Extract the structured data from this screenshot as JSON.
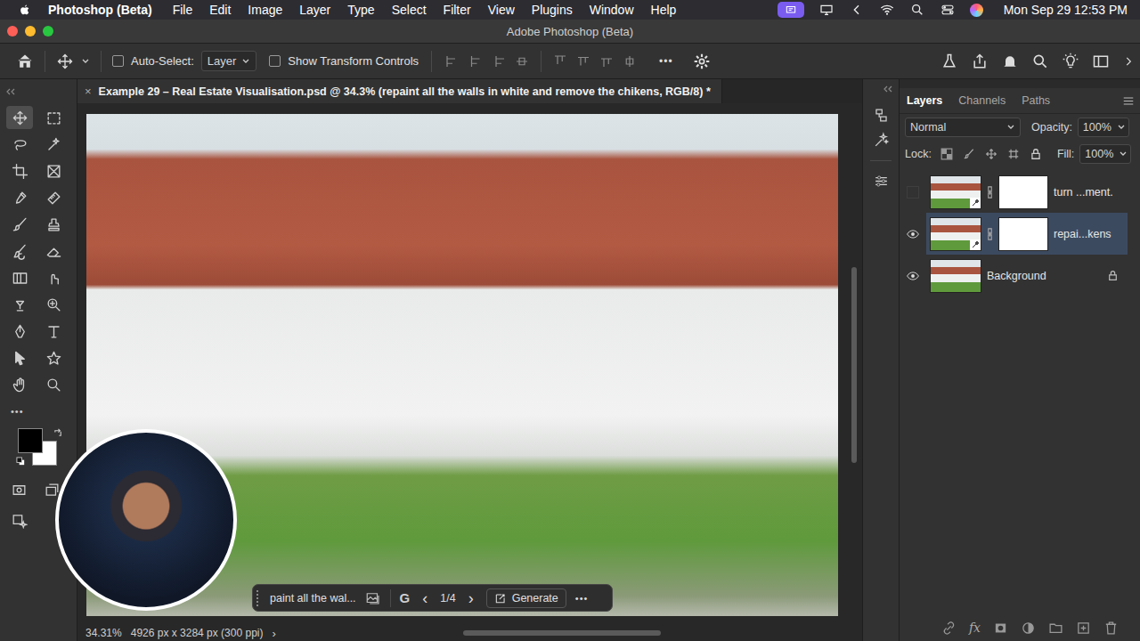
{
  "menubar": {
    "app": "Photoshop (Beta)",
    "menus": [
      "File",
      "Edit",
      "Image",
      "Layer",
      "Type",
      "Select",
      "Filter",
      "View",
      "Plugins",
      "Window",
      "Help"
    ],
    "clock": "Mon Sep 29  12:53 PM"
  },
  "window": {
    "title": "Adobe Photoshop (Beta)"
  },
  "options_bar": {
    "auto_select": {
      "label": "Auto-Select:",
      "checked": false
    },
    "target": "Layer",
    "transform": {
      "label": "Show Transform Controls",
      "checked": false
    },
    "more": "•••"
  },
  "toolbar": {
    "tools": [
      {
        "kind": "move",
        "selected": true
      },
      {
        "kind": "marquee",
        "selected": false
      },
      {
        "kind": "lasso",
        "selected": false
      },
      {
        "kind": "quick-select",
        "selected": false
      },
      {
        "kind": "crop",
        "selected": false
      },
      {
        "kind": "frame",
        "selected": false
      },
      {
        "kind": "eyedropper",
        "selected": false
      },
      {
        "kind": "healing",
        "selected": false
      },
      {
        "kind": "brush",
        "selected": false
      },
      {
        "kind": "stamp",
        "selected": false
      },
      {
        "kind": "history-brush",
        "selected": false
      },
      {
        "kind": "eraser",
        "selected": false
      },
      {
        "kind": "gradient",
        "selected": false
      },
      {
        "kind": "smudge",
        "selected": false
      },
      {
        "kind": "dodge",
        "selected": false
      },
      {
        "kind": "sponge",
        "selected": false
      },
      {
        "kind": "pen",
        "selected": false
      },
      {
        "kind": "type",
        "selected": false
      },
      {
        "kind": "path-select",
        "selected": false
      },
      {
        "kind": "shape",
        "selected": false
      },
      {
        "kind": "hand",
        "selected": false
      },
      {
        "kind": "zoom",
        "selected": false
      }
    ],
    "more": "•••",
    "foreground_color": "#000000",
    "background_color": "#ffffff"
  },
  "document": {
    "close": "×",
    "title": "Example 29 – Real Estate Visualisation.psd @ 34.3% (repaint all the walls in white and remove the chikens, RGB/8) *"
  },
  "contextual_taskbar": {
    "prompt": "paint all the wal...",
    "model_badge": "G",
    "prev": "‹",
    "counter": "1/4",
    "next": "›",
    "generate": "Generate",
    "more": "•••"
  },
  "status_bar": {
    "zoom": "34.31%",
    "dimensions": "4926 px x 3284 px (300 ppi)",
    "arrow": "›"
  },
  "layers_panel": {
    "tabs": [
      {
        "label": "Layers",
        "selected": true
      },
      {
        "label": "Channels",
        "selected": false
      },
      {
        "label": "Paths",
        "selected": false
      }
    ],
    "blend_mode": "Normal",
    "opacity": {
      "label": "Opacity:",
      "value": "100%"
    },
    "lock_label": "Lock:",
    "fill": {
      "label": "Fill:",
      "value": "100%"
    },
    "layers": [
      {
        "name": "turn ...ment.",
        "kind": "generative",
        "visible": false,
        "selected": false,
        "locked": false
      },
      {
        "name": "repai...kens",
        "kind": "generative",
        "visible": true,
        "selected": true,
        "locked": false
      },
      {
        "name": "Background",
        "kind": "pixel",
        "visible": true,
        "selected": false,
        "locked": true
      }
    ],
    "footer_fx": "fx"
  }
}
